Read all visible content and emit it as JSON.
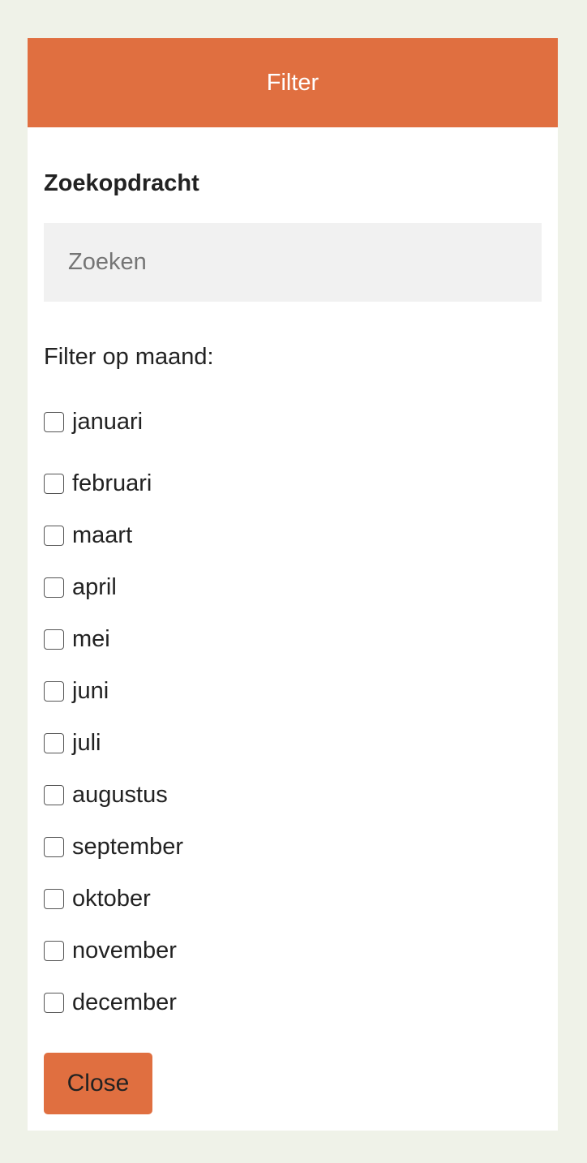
{
  "header": {
    "title": "Filter"
  },
  "search": {
    "label": "Zoekopdracht",
    "placeholder": "Zoeken",
    "value": ""
  },
  "month_filter": {
    "label": "Filter op maand:",
    "months": [
      {
        "label": "januari",
        "checked": false
      },
      {
        "label": "februari",
        "checked": false
      },
      {
        "label": "maart",
        "checked": false
      },
      {
        "label": "april",
        "checked": false
      },
      {
        "label": "mei",
        "checked": false
      },
      {
        "label": "juni",
        "checked": false
      },
      {
        "label": "juli",
        "checked": false
      },
      {
        "label": "augustus",
        "checked": false
      },
      {
        "label": "september",
        "checked": false
      },
      {
        "label": "oktober",
        "checked": false
      },
      {
        "label": "november",
        "checked": false
      },
      {
        "label": "december",
        "checked": false
      }
    ]
  },
  "close_button": {
    "label": "Close"
  },
  "colors": {
    "accent": "#e06f40",
    "page_background": "#eff2e8",
    "panel_background": "#ffffff",
    "input_background": "#f1f1f1"
  }
}
